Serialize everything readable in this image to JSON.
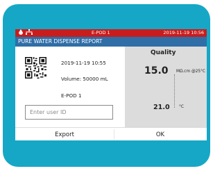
{
  "status_bar": {
    "device_title": "E-POD 1",
    "datetime": "2019-11-19 10:56",
    "icons": [
      "droplet-alert-icon",
      "network-icon"
    ]
  },
  "dialog": {
    "title": "PURE WATER DISPENSE REPORT",
    "date_time": "2019-11-19   10:55",
    "volume": "Volume: 50000 mL",
    "device": "E-POD 1",
    "user_id_placeholder": "Enter user ID",
    "quality": {
      "title": "Quality",
      "resistivity": "15.0",
      "resistivity_unit": "MΩ.cm @25°C",
      "temperature": "21.0",
      "temperature_unit": "°C"
    },
    "buttons": {
      "export": "Export",
      "ok": "OK"
    }
  },
  "colors": {
    "device_frame": "#17a7c6",
    "status_bar": "#c81d1d",
    "dialog_header": "#2f6ea7",
    "quality_panel": "#dcdcdc"
  }
}
